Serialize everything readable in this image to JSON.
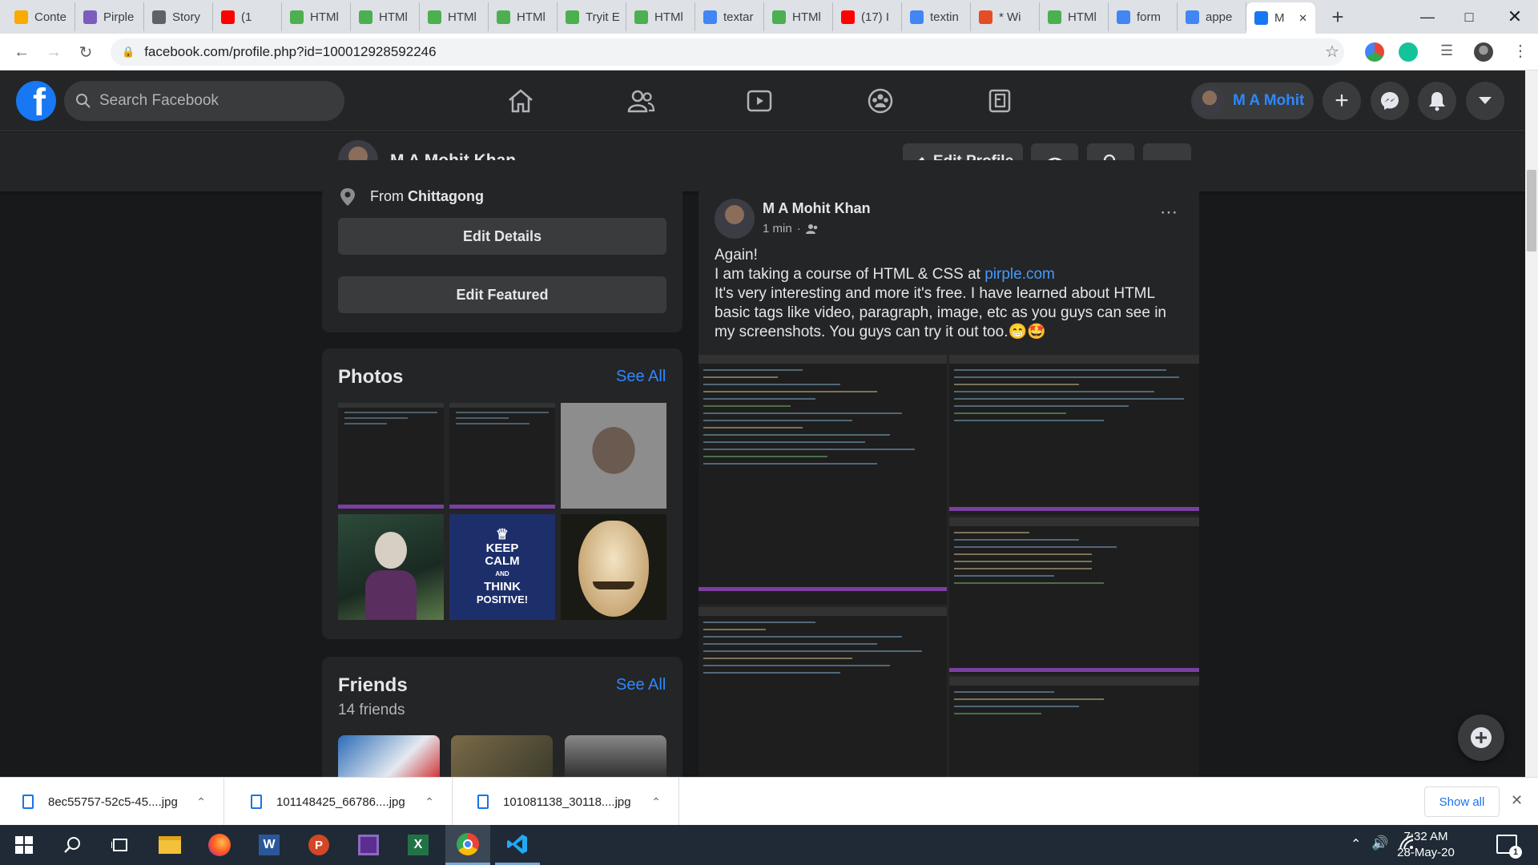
{
  "browser": {
    "tabs": [
      {
        "label": "Conte",
        "icon": "analytics-icon",
        "color": "#f9ab00"
      },
      {
        "label": "Pirple",
        "icon": "pirple-icon",
        "color": "#7c5cbf"
      },
      {
        "label": "Story",
        "icon": "globe-icon",
        "color": "#5f6368"
      },
      {
        "label": "(1",
        "icon": "youtube-icon",
        "color": "#ff0000"
      },
      {
        "label": "HTMl",
        "icon": "w3schools-icon",
        "color": "#4caf50"
      },
      {
        "label": "HTMl",
        "icon": "w3schools-icon",
        "color": "#4caf50"
      },
      {
        "label": "HTMl",
        "icon": "w3schools-icon",
        "color": "#4caf50"
      },
      {
        "label": "HTMl",
        "icon": "w3schools-icon",
        "color": "#4caf50"
      },
      {
        "label": "Tryit E",
        "icon": "w3schools-icon",
        "color": "#4caf50"
      },
      {
        "label": "HTMl",
        "icon": "w3schools-icon",
        "color": "#4caf50"
      },
      {
        "label": "textar",
        "icon": "google-icon",
        "color": "#4285f4"
      },
      {
        "label": "HTMl",
        "icon": "w3schools-icon",
        "color": "#4caf50"
      },
      {
        "label": "(17) I",
        "icon": "youtube-icon",
        "color": "#ff0000"
      },
      {
        "label": "textin",
        "icon": "google-icon",
        "color": "#4285f4"
      },
      {
        "label": "* Wi",
        "icon": "html5-icon",
        "color": "#e44d26"
      },
      {
        "label": "HTMl",
        "icon": "w3schools-icon",
        "color": "#4caf50"
      },
      {
        "label": "form",
        "icon": "google-icon",
        "color": "#4285f4"
      },
      {
        "label": "appe",
        "icon": "google-icon",
        "color": "#4285f4"
      },
      {
        "label": "M",
        "icon": "facebook-icon",
        "color": "#1877f2",
        "active": true
      }
    ],
    "url": "facebook.com/profile.php?id=100012928592246"
  },
  "fb": {
    "search_placeholder": "Search Facebook",
    "user_short": "M A Mohit",
    "profile_name": "M A Mohit Khan",
    "edit_profile": "Edit Profile",
    "intro": {
      "from_prefix": "From ",
      "from_city": "Chittagong",
      "edit_details": "Edit Details",
      "edit_featured": "Edit Featured"
    },
    "photos": {
      "title": "Photos",
      "see_all": "See All",
      "keep_calm": [
        "KEEP",
        "CALM",
        "AND",
        "THINK",
        "POSITIVE!"
      ]
    },
    "friends": {
      "title": "Friends",
      "see_all": "See All",
      "count": "14 friends"
    },
    "post": {
      "author": "M A Mohit Khan",
      "time": "1 min",
      "line1": "Again!",
      "line2_prefix": "I am taking a course of HTML & CSS at ",
      "link": "pirple.com",
      "line3": "It's very interesting and more it's free. I have learned about HTML basic tags like video, paragraph, image, etc as you guys can see in my screenshots. You guys can try it out too.",
      "emoji": "😁🤩"
    }
  },
  "downloads": {
    "items": [
      "8ec55757-52c5-45....jpg",
      "101148425_66786....jpg",
      "101081138_30118....jpg"
    ],
    "show_all": "Show all"
  },
  "taskbar": {
    "time": "7:32 AM",
    "date": "28-May-20",
    "notif_count": "1"
  }
}
